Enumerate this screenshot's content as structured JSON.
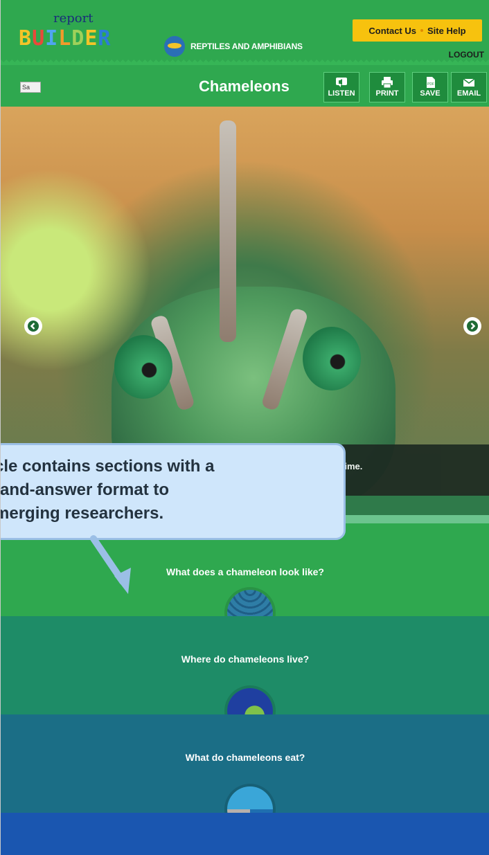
{
  "header": {
    "logo_small": "report",
    "logo_big": "BUILDER",
    "product": "REPTILES AND AMPHIBIANS",
    "contact_label": "Contact Us",
    "help_label": "Site Help",
    "logout_label": "LOGOUT"
  },
  "toolbar": {
    "save_box_text": "Sa",
    "title": "Chameleons",
    "buttons": [
      {
        "label": "LISTEN",
        "icon": "speaker-icon"
      },
      {
        "label": "PRINT",
        "icon": "printer-icon"
      },
      {
        "label": "SAVE",
        "icon": "pdf-icon"
      },
      {
        "label": "EMAIL",
        "icon": "envelope-icon"
      }
    ]
  },
  "hero": {
    "caption_fragment": "time.",
    "prev_icon": "arrow-left-icon",
    "next_icon": "arrow-right-icon"
  },
  "sections": [
    {
      "question": "What does a chameleon look like?",
      "color": "#2fa84f"
    },
    {
      "question": "Where do chameleons live?",
      "color": "#1e8c67"
    },
    {
      "question": "What do chameleons eat?",
      "color": "#1b6e86"
    }
  ],
  "callout": {
    "line1": "cle contains sections with a",
    "line2": "-and-answer format to",
    "line3": "merging researchers."
  },
  "colors": {
    "brand_green": "#2fa84f",
    "accent_yellow": "#f7c20e",
    "deep_blue": "#1a56b0"
  }
}
